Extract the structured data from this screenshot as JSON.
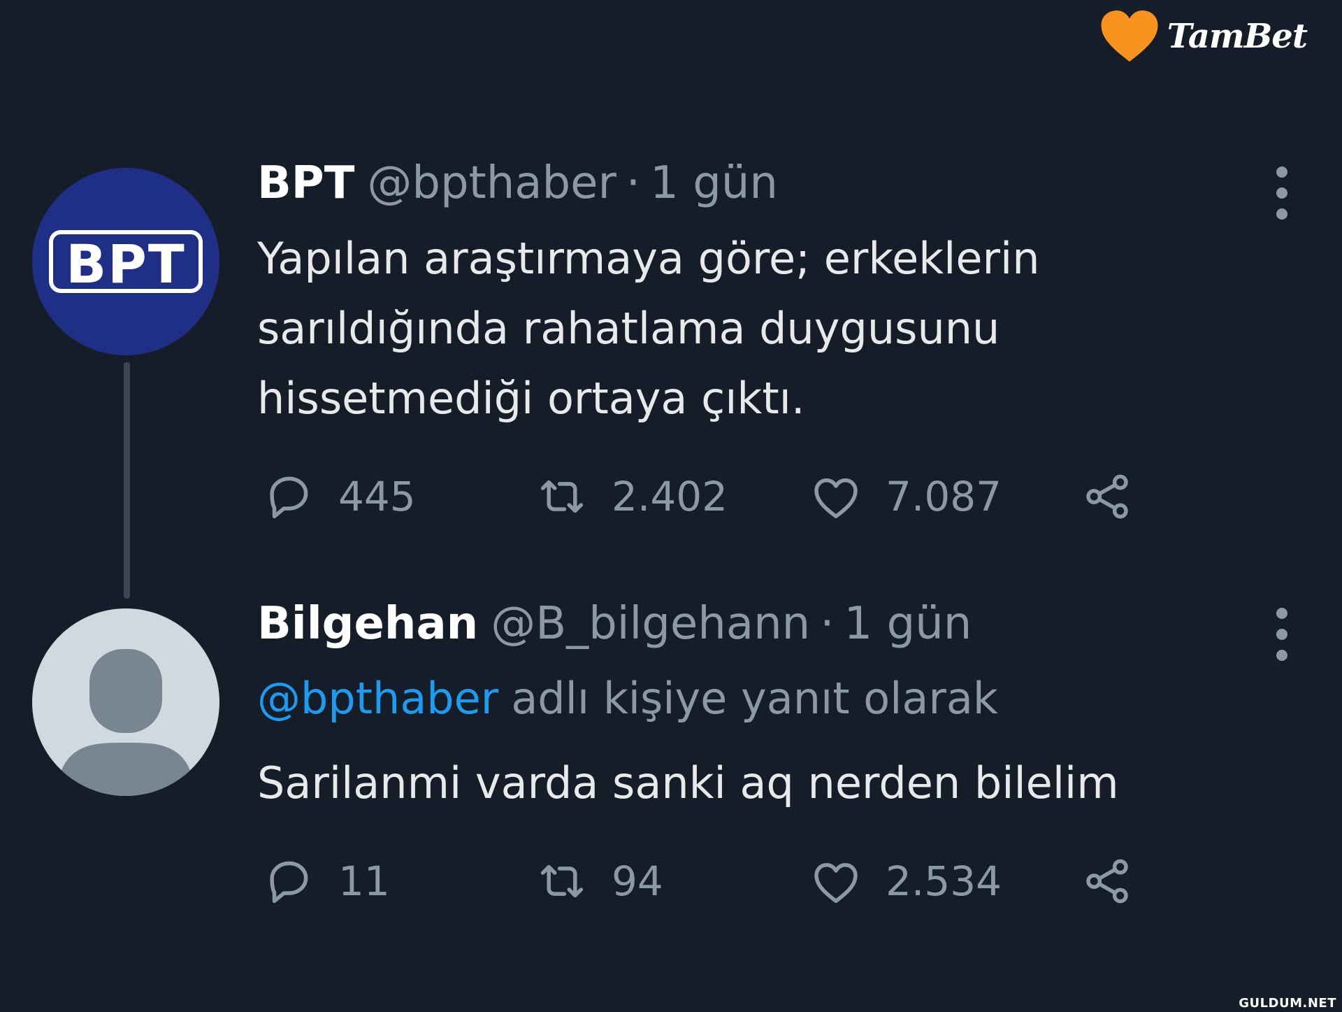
{
  "logo": {
    "text": "TamBet",
    "heart_color": "#f7931e"
  },
  "tweets": [
    {
      "name": "BPT",
      "handle": "@bpthaber",
      "separator": "·",
      "time": "1 gün",
      "avatar_text": "BPT",
      "avatar_color": "#1f2f86",
      "text_lines": [
        "Yapılan araştırmaya göre; erkeklerin",
        "sarıldığında rahatlama duygusunu",
        "hissetmediği ortaya çıktı."
      ],
      "stats": {
        "replies": "445",
        "retweets": "2.402",
        "likes": "7.087"
      }
    },
    {
      "name": "Bilgehan",
      "handle": "@B_bilgehann",
      "separator": "·",
      "time": "1 gün",
      "reply_mention": "@bpthaber",
      "reply_suffix": "adlı kişiye yanıt olarak",
      "text_lines": [
        "Sarilanmi varda sanki aq nerden bilelim"
      ],
      "stats": {
        "replies": "11",
        "retweets": "94",
        "likes": "2.534"
      }
    }
  ],
  "icons": [
    "reply-icon",
    "retweet-icon",
    "like-icon",
    "share-icon",
    "more-icon"
  ],
  "colors": {
    "background": "#151d28",
    "text": "#e7e9ea",
    "muted": "#8b98a5",
    "link": "#1d9bf0"
  },
  "watermark": "GULDUM.NET"
}
